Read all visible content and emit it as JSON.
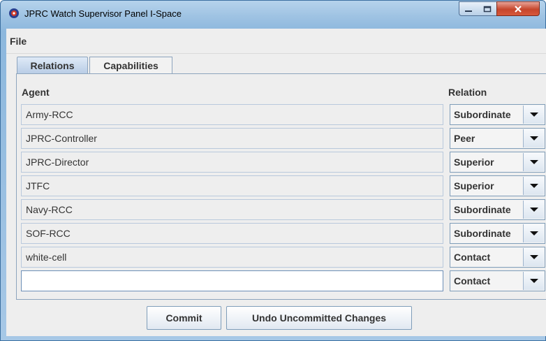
{
  "window": {
    "title": "JPRC Watch Supervisor Panel I-Space",
    "icon": "jprc-app-icon",
    "controls": [
      "minimize-icon",
      "maximize-icon",
      "close-icon"
    ]
  },
  "menu": {
    "items": [
      {
        "label": "File"
      }
    ]
  },
  "tabs": [
    {
      "label": "Relations",
      "selected": true
    },
    {
      "label": "Capabilities",
      "selected": false
    }
  ],
  "table": {
    "headers": {
      "agent": "Agent",
      "relation": "Relation"
    },
    "rows": [
      {
        "agent": "Army-RCC",
        "relation": "Subordinate"
      },
      {
        "agent": "JPRC-Controller",
        "relation": "Peer"
      },
      {
        "agent": "JPRC-Director",
        "relation": "Superior"
      },
      {
        "agent": "JTFC",
        "relation": "Superior"
      },
      {
        "agent": "Navy-RCC",
        "relation": "Subordinate"
      },
      {
        "agent": "SOF-RCC",
        "relation": "Subordinate"
      },
      {
        "agent": "white-cell",
        "relation": "Contact"
      }
    ],
    "new_row": {
      "agent": "",
      "relation": "Contact"
    }
  },
  "buttons": {
    "commit": "Commit",
    "undo": "Undo Uncommitted Changes"
  },
  "colors": {
    "title_gradient_top": "#b6d3ec",
    "close_red": "#c6462c",
    "panel_border": "#8da4bd"
  }
}
